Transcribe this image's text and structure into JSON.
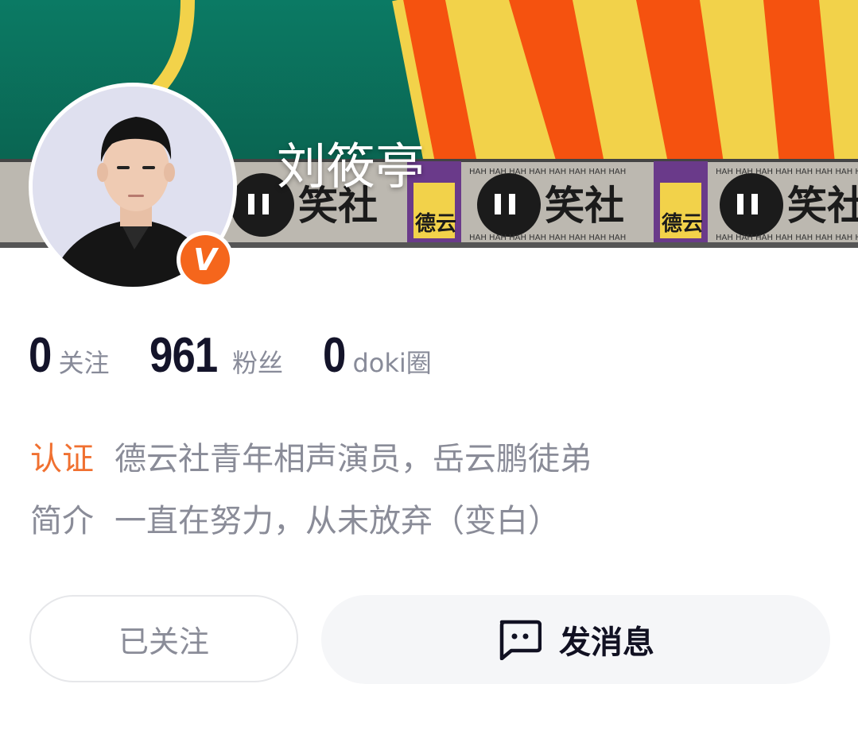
{
  "profile": {
    "name": "刘筱亭",
    "verified_badge": "V"
  },
  "stats": [
    {
      "count": "0",
      "label": "关注"
    },
    {
      "count": "961",
      "label": "粉丝"
    },
    {
      "count": "0",
      "label": "doki圈"
    }
  ],
  "info": {
    "cert_key": "认证",
    "cert_value": "德云社青年相声演员，岳云鹏徒弟",
    "intro_key": "简介",
    "intro_value": "一直在努力，从未放弃（变白）"
  },
  "actions": {
    "follow_label": "已关注",
    "message_label": "发消息"
  },
  "banner": {
    "logo_text": "笑社",
    "side_text": "德云",
    "strip_text": "HAH HAH HAH HAH HAH HAH HAH HAH",
    "icons": [
      "message-icon",
      "verified-v-icon"
    ]
  },
  "colors": {
    "accent": "#f07030",
    "badge": "#f5661c",
    "banner_green": "#0e6e5c",
    "stripe_orange": "#f5520f",
    "stripe_yellow": "#f2d24a"
  }
}
